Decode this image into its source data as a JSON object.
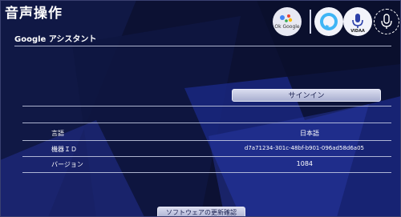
{
  "header": {
    "title": "音声操作"
  },
  "assistants": {
    "google_label": "Ok Google",
    "vidaa_label": "VIDAA"
  },
  "section": {
    "title": "Google アシスタント"
  },
  "signin_button": "サインイン",
  "info_rows": [
    {
      "label": "言語",
      "value": "日本語"
    },
    {
      "label": "機器ＩＤ",
      "value": "d7a71234-301c-48bf-b901-096ad58d6a05"
    },
    {
      "label": "バージョン",
      "value": "1084"
    }
  ],
  "update_button": "ソフトウェアの更新確認",
  "colors": {
    "background": "#0d1235",
    "accent_blue": "#3fb5f5",
    "button": "#c3c7e2"
  }
}
